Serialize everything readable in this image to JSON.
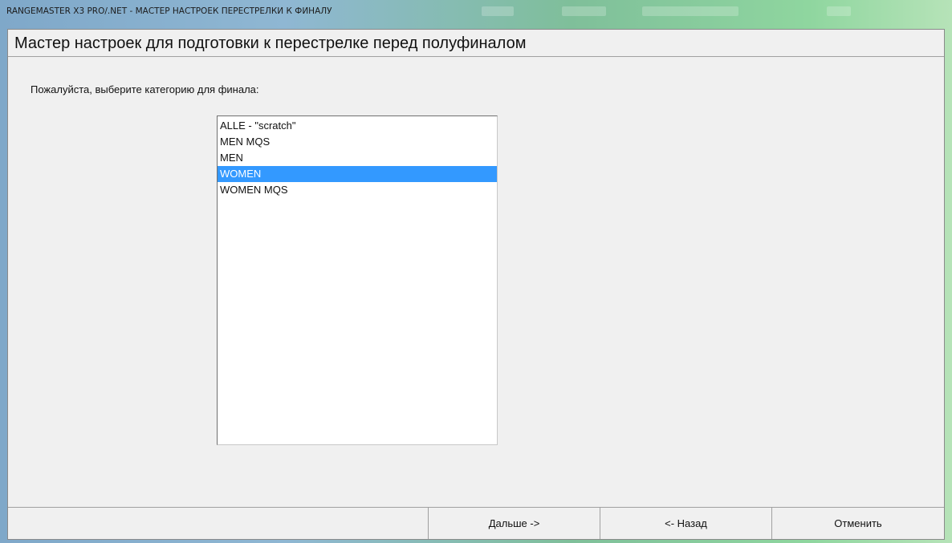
{
  "window": {
    "title": "RANGEMASTER X3 PRO/.NET - МАСТЕР НАСТРОЕК ПЕРЕСТРЕЛКИ К ФИНАЛУ"
  },
  "wizard": {
    "heading": "Мастер настроек  для подготовки к перестрелке перед полуфиналом",
    "prompt": "Пожалуйста, выберите категорию для финала:",
    "categories": [
      {
        "label": "ALLE - \"scratch\"",
        "selected": false
      },
      {
        "label": "MEN MQS",
        "selected": false
      },
      {
        "label": "MEN",
        "selected": false
      },
      {
        "label": "WOMEN",
        "selected": true
      },
      {
        "label": "WOMEN MQS",
        "selected": false
      }
    ]
  },
  "footer": {
    "next_label": "Дальше ->",
    "back_label": "<- Назад",
    "cancel_label": "Отменить"
  },
  "colors": {
    "selection": "#3399ff",
    "client_bg": "#f0f0f0"
  }
}
